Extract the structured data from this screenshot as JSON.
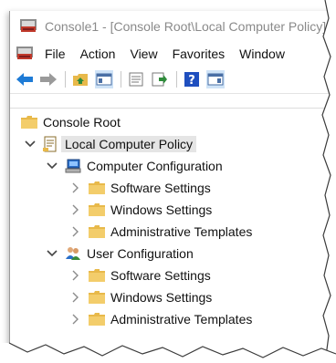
{
  "window": {
    "title": "Console1 - [Console Root\\Local Computer Policy]"
  },
  "menu": {
    "items": [
      "File",
      "Action",
      "View",
      "Favorites",
      "Window"
    ]
  },
  "toolbar": {
    "buttons": [
      "back",
      "forward",
      "up-folder",
      "show-hide-console-tree",
      "properties",
      "export-list",
      "help",
      "show-hide-action-pane"
    ]
  },
  "tree": {
    "root": "Console Root",
    "local_policy": "Local Computer Policy",
    "computer_config": {
      "label": "Computer Configuration",
      "children": [
        "Software Settings",
        "Windows Settings",
        "Administrative Templates"
      ]
    },
    "user_config": {
      "label": "User Configuration",
      "children": [
        "Software Settings",
        "Windows Settings",
        "Administrative Templates"
      ]
    }
  },
  "colors": {
    "folder": "#e8b94a",
    "folder_dark": "#c9962a",
    "arrow_blue": "#1e7bd6",
    "selection": "#e5e5e5"
  }
}
